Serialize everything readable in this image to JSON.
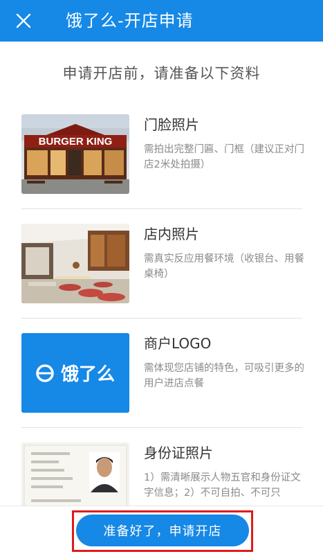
{
  "header": {
    "title": "饿了么-开店申请",
    "close_icon": "close-icon"
  },
  "intro": {
    "text": "申请开店前，请准备以下资料"
  },
  "materials": [
    {
      "title": "门脸照片",
      "desc": "需拍出完整门匾、门框（建议正对门店2米处拍摄）",
      "image": "storefront-photo",
      "sign_text": "BURGER KING"
    },
    {
      "title": "店内照片",
      "desc": "需真实反应用餐环境（收银台、用餐桌椅）",
      "image": "interior-photo"
    },
    {
      "title": "商户LOGO",
      "desc": "需体现您店铺的特色，可吸引更多的用户进店点餐",
      "image": "logo-image",
      "logo_text": "饿了么",
      "logo_bg": "#1688e6"
    },
    {
      "title": "身份证照片",
      "desc": "1）需清晰展示人物五官和身份证文字信息；2）不可自拍、不可只",
      "image": "id-card-photo"
    }
  ],
  "footer": {
    "button_label": "准备好了，申请开店",
    "accent": "#1688e6",
    "highlight_color": "#e01b1b"
  }
}
